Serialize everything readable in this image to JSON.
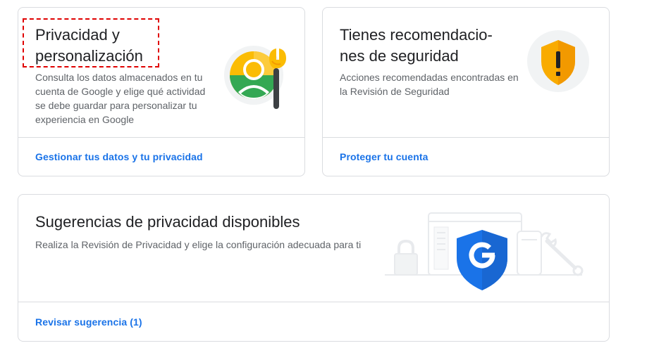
{
  "cards": {
    "privacy": {
      "title": "Privacidad y personalización",
      "description": "Consulta los datos almacenados en tu cuenta de Google y elige qué activi­dad se debe guardar para personali­zar tu experiencia en Google",
      "link": "Gestionar tus datos y tu privacidad",
      "illustration_icon": "privacy-avatar-wrench-icon"
    },
    "security": {
      "title": "Tienes recomendacio­nes de seguridad",
      "description": "Acciones recomendadas encontradas en la Revisión de Seguridad",
      "link": "Proteger tu cuenta",
      "illustration_icon": "warning-shield-icon"
    },
    "suggestions": {
      "title": "Sugerencias de privacidad disponibles",
      "description": "Realiza la Revisión de Privacidad y elige la configuración adecuada para ti",
      "link": "Revisar sugerencia (1)",
      "illustration_icon": "google-shield-devices-icon"
    }
  },
  "colors": {
    "link": "#1a73e8",
    "border": "#dadce0",
    "title": "#202124",
    "description": "#5f6368",
    "highlight": "#e00000",
    "google_blue": "#1a73e8",
    "warning_yellow": "#f9ab00",
    "green": "#34a853"
  }
}
